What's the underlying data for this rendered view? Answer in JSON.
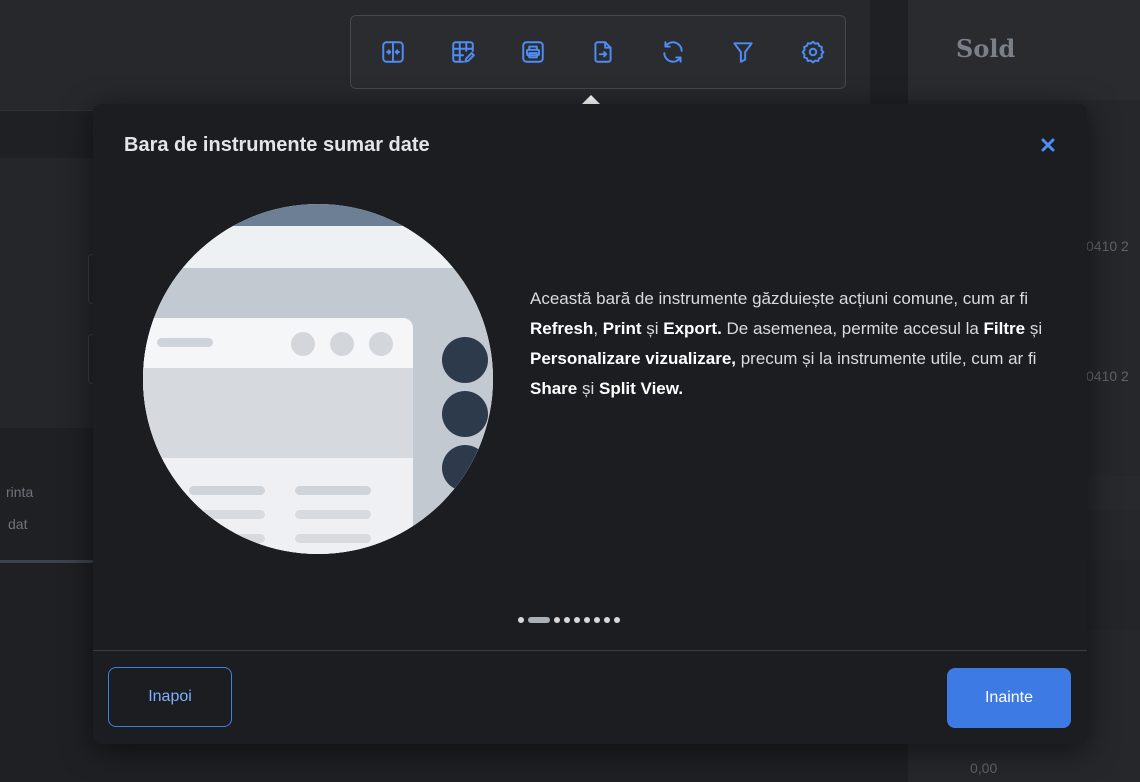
{
  "background": {
    "right_panel_title": "Sold",
    "right_rows": [
      "0410 2",
      "0410 2"
    ],
    "left_labels": [
      "rinta",
      "dat"
    ],
    "bottom_value": "0,00"
  },
  "toolbar": {
    "accent_color": "#4d8df5",
    "icons": [
      "split-view-icon",
      "customize-view-icon",
      "print-icon",
      "export-icon",
      "refresh-icon",
      "filter-icon",
      "settings-icon"
    ]
  },
  "modal": {
    "title": "Bara de instrumente sumar date",
    "body": {
      "t1": "Această bară de instrumente găzduiește acțiuni comune, cum ar fi ",
      "refresh": "Refresh",
      "t2": ", ",
      "print": "Print",
      "t3": " și ",
      "export": "Export.",
      "t4": " De asemenea, permite accesul la ",
      "filtre": "Filtre",
      "t5": " și ",
      "personalizare": "Personalizare vizualizare,",
      "t6": " precum și la instrumente utile, cum ar fi ",
      "share": "Share",
      "t7": " și ",
      "split": "Split View."
    },
    "pagination": {
      "current": 2,
      "total": 9
    },
    "back_label": "Inapoi",
    "next_label": "Inainte"
  }
}
